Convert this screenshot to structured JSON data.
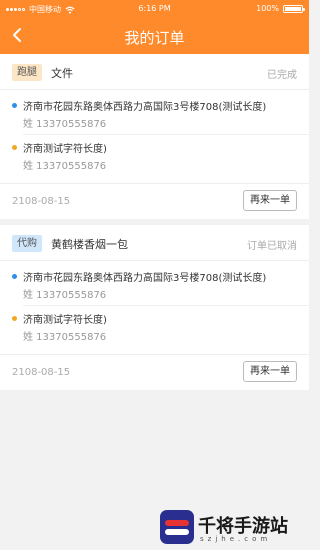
{
  "status_bar": {
    "carrier": "中国移动",
    "time": "6:16 PM",
    "battery": "100%"
  },
  "nav": {
    "title": "我的订单",
    "back_icon": "chevron-left-icon"
  },
  "orders": [
    {
      "tag": "跑腿",
      "title": "文件",
      "state": "已完成",
      "pickup_address": "济南市花园东路奥体西路力高国际3号楼708(测试长度)",
      "pickup_person": "姓 13370555876",
      "delivery_address": "济南测试字符长度)",
      "delivery_person": "姓 13370555876",
      "date": "2108-08-15",
      "action_label": "再来一单"
    },
    {
      "tag": "代购",
      "title": "黄鹤楼香烟一包",
      "state": "订单已取消",
      "pickup_address": "济南市花园东路奥体西路力高国际3号楼708(测试长度)",
      "pickup_person": "姓 13370555876",
      "delivery_address": "济南测试字符长度)",
      "delivery_person": "姓 13370555876",
      "date": "2108-08-15",
      "action_label": "再来一单"
    }
  ],
  "watermark": {
    "brand": "千将手游站",
    "domain": "szjhe.com"
  },
  "colors": {
    "accent": "#ff8a2b",
    "pickup_dot": "#2f8ee8",
    "delivery_dot": "#f5a623"
  }
}
